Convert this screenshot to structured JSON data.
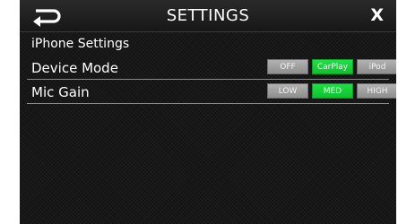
{
  "titlebar": {
    "title": "SETTINGS",
    "back_icon": "back-arrow-icon",
    "close_label": "X"
  },
  "section": {
    "header": "iPhone Settings"
  },
  "settings": {
    "device_mode": {
      "label": "Device Mode",
      "options": [
        "OFF",
        "CarPlay",
        "iPod"
      ],
      "selected": "CarPlay"
    },
    "mic_gain": {
      "label": "Mic Gain",
      "options": [
        "LOW",
        "MED",
        "HIGH"
      ],
      "selected": "MED"
    }
  },
  "colors": {
    "active": "#16d63a",
    "inactive": "#a3a3a3",
    "background": "#121212"
  }
}
